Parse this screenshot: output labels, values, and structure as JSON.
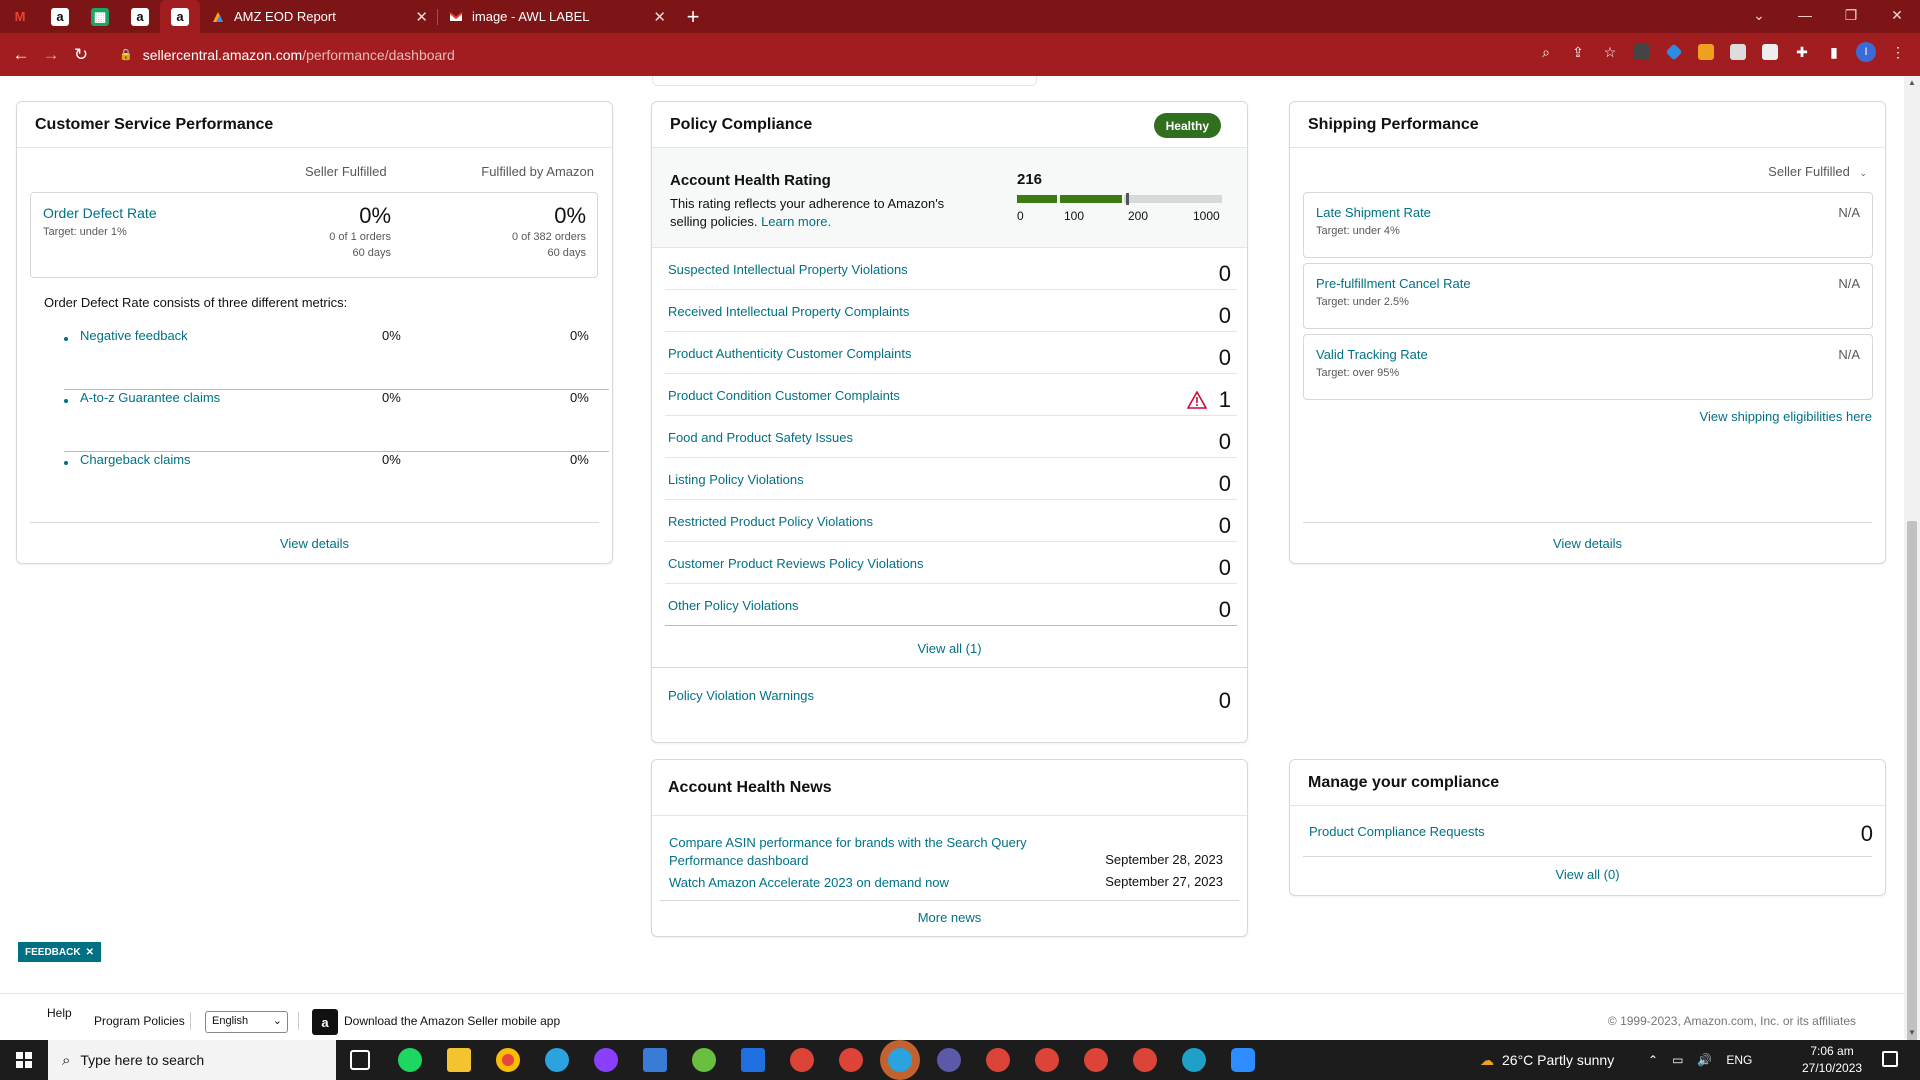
{
  "browser": {
    "tabs": [
      {
        "title": "AMZ EOD Report",
        "close": "✕"
      },
      {
        "title": "image - AWL LABEL",
        "close": "✕"
      }
    ],
    "new_tab": "+",
    "url_host": "sellercentral.amazon.com",
    "url_path": "/performance/dashboard",
    "avatar_letter": "I"
  },
  "customer_service": {
    "title": "Customer Service Performance",
    "col_seller": "Seller Fulfilled",
    "col_fba": "Fulfilled by Amazon",
    "odr": {
      "label": "Order Defect Rate",
      "target": "Target: under 1%",
      "seller_value": "0%",
      "seller_orders": "0 of 1 orders",
      "seller_period": "60 days",
      "fba_value": "0%",
      "fba_orders": "0 of 382 orders",
      "fba_period": "60 days"
    },
    "note": "Order Defect Rate consists of three different metrics:",
    "metrics": [
      {
        "name": "Negative feedback",
        "seller": "0%",
        "fba": "0%"
      },
      {
        "name": "A-to-z Guarantee claims",
        "seller": "0%",
        "fba": "0%"
      },
      {
        "name": "Chargeback claims",
        "seller": "0%",
        "fba": "0%"
      }
    ],
    "view_details": "View details"
  },
  "policy_compliance": {
    "title": "Policy Compliance",
    "badge": "Healthy",
    "badge_color": "#2f6f1e",
    "rating_title": "Account Health Rating",
    "rating_desc": "This rating reflects your adherence to Amazon's selling policies.",
    "rating_learn_more": "Learn more.",
    "rating_value": "216",
    "rating_ticks": [
      "0",
      "100",
      "200",
      "1000"
    ],
    "rows": [
      {
        "label": "Suspected Intellectual Property Violations",
        "value": "0"
      },
      {
        "label": "Received Intellectual Property Complaints",
        "value": "0"
      },
      {
        "label": "Product Authenticity Customer Complaints",
        "value": "0"
      },
      {
        "label": "Product Condition Customer Complaints",
        "value": "1"
      },
      {
        "label": "Food and Product Safety Issues",
        "value": "0"
      },
      {
        "label": "Listing Policy Violations",
        "value": "0"
      },
      {
        "label": "Restricted Product Policy Violations",
        "value": "0"
      },
      {
        "label": "Customer Product Reviews Policy Violations",
        "value": "0"
      },
      {
        "label": "Other Policy Violations",
        "value": "0"
      }
    ],
    "view_all": "View all (1)",
    "warnings_label": "Policy Violation Warnings",
    "warnings_value": "0"
  },
  "shipping": {
    "title": "Shipping Performance",
    "filter": "Seller Fulfilled",
    "items": [
      {
        "name": "Late Shipment Rate",
        "target": "Target: under 4%",
        "value": "N/A"
      },
      {
        "name": "Pre-fulfillment Cancel Rate",
        "target": "Target: under 2.5%",
        "value": "N/A"
      },
      {
        "name": "Valid Tracking Rate",
        "target": "Target: over 95%",
        "value": "N/A"
      }
    ],
    "eligibility_link": "View shipping eligibilities here",
    "view_details": "View details"
  },
  "news": {
    "title": "Account Health News",
    "items": [
      {
        "title": "Compare ASIN performance for brands with the Search Query Performance dashboard",
        "date": "September 28, 2023"
      },
      {
        "title": "Watch Amazon Accelerate 2023 on demand now",
        "date": "September 27, 2023"
      }
    ],
    "more": "More news"
  },
  "compliance": {
    "title": "Manage your compliance",
    "row_label": "Product Compliance Requests",
    "row_value": "0",
    "view_all": "View all (0)"
  },
  "footer": {
    "help": "Help",
    "program_policies": "Program Policies",
    "language": "English",
    "app_download": "Download the Amazon Seller mobile app",
    "copyright": "© 1999-2023, Amazon.com, Inc. or its affiliates",
    "feedback": "FEEDBACK",
    "feedback_close": "✕"
  },
  "taskbar": {
    "search_placeholder": "Type here to search",
    "weather": "26°C  Partly sunny",
    "lang": "ENG",
    "time": "7:06 am",
    "date": "27/10/2023"
  }
}
